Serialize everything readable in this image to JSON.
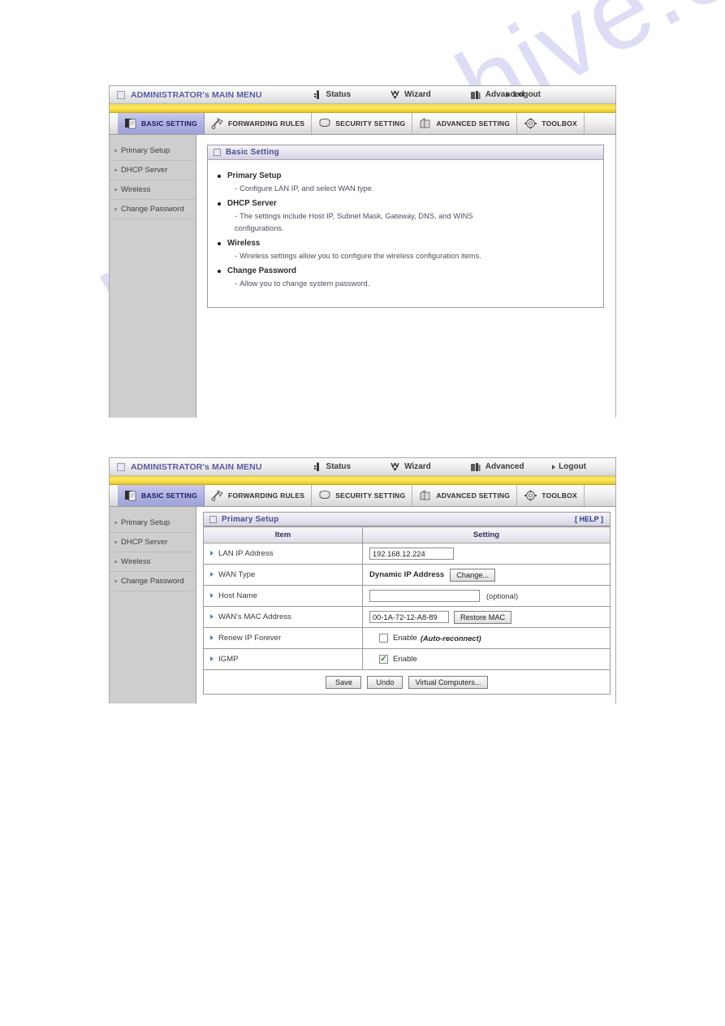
{
  "watermark": {
    "text": "manualshive.com"
  },
  "topbar": {
    "admin_title": "ADMINISTRATOR's MAIN MENU",
    "items": [
      {
        "label": "Status",
        "icon": "status-icon"
      },
      {
        "label": "Wizard",
        "icon": "wizard-icon"
      },
      {
        "label": "Advanced",
        "icon": "advanced-icon"
      },
      {
        "label": "Logout",
        "icon": "logout-arrow-icon"
      }
    ]
  },
  "tabs": [
    {
      "label": "BASIC SETTING",
      "icon": "basic-setting-icon",
      "active": true
    },
    {
      "label": "FORWARDING RULES",
      "icon": "forwarding-rules-icon",
      "active": false
    },
    {
      "label": "SECURITY SETTING",
      "icon": "security-setting-icon",
      "active": false
    },
    {
      "label": "ADVANCED SETTING",
      "icon": "advanced-setting-icon",
      "active": false
    },
    {
      "label": "TOOLBOX",
      "icon": "toolbox-icon",
      "active": false
    }
  ],
  "sidebar": {
    "items": [
      {
        "label": "Primary Setup"
      },
      {
        "label": "DHCP Server"
      },
      {
        "label": "Wireless"
      },
      {
        "label": "Change Password"
      }
    ]
  },
  "basic_setting": {
    "title": "Basic Setting",
    "entries": [
      {
        "heading": "Primary Setup",
        "desc": "Configure LAN IP, and select WAN type."
      },
      {
        "heading": "DHCP Server",
        "desc": "The settings include Host IP, Subnet Mask, Gateway, DNS, and WINS configurations."
      },
      {
        "heading": "Wireless",
        "desc": "Wireless settings allow you to configure the wireless configuration items."
      },
      {
        "heading": "Change Password",
        "desc": "Allow you to change system password."
      }
    ]
  },
  "primary_setup": {
    "title": "Primary Setup",
    "help_label": "[ HELP ]",
    "columns": {
      "item": "Item",
      "setting": "Setting"
    },
    "rows": [
      {
        "item": "LAN IP Address",
        "value": "192.168.12.224"
      },
      {
        "item": "WAN Type",
        "value": "Dynamic IP Address",
        "button": "Change..."
      },
      {
        "item": "Host Name",
        "value": "",
        "note": "(optional)"
      },
      {
        "item": "WAN's MAC Address",
        "value": "00-1A-72-12-A8-89",
        "button": "Restore MAC"
      },
      {
        "item": "Renew IP Forever",
        "checkbox_label": "Enable",
        "checkbox_note": "(Auto-reconnect)",
        "checked": false
      },
      {
        "item": "IGMP",
        "checkbox_label": "Enable",
        "checkbox_note": "",
        "checked": true
      }
    ],
    "buttons": [
      {
        "label": "Save"
      },
      {
        "label": "Undo"
      },
      {
        "label": "Virtual Computers..."
      }
    ]
  }
}
